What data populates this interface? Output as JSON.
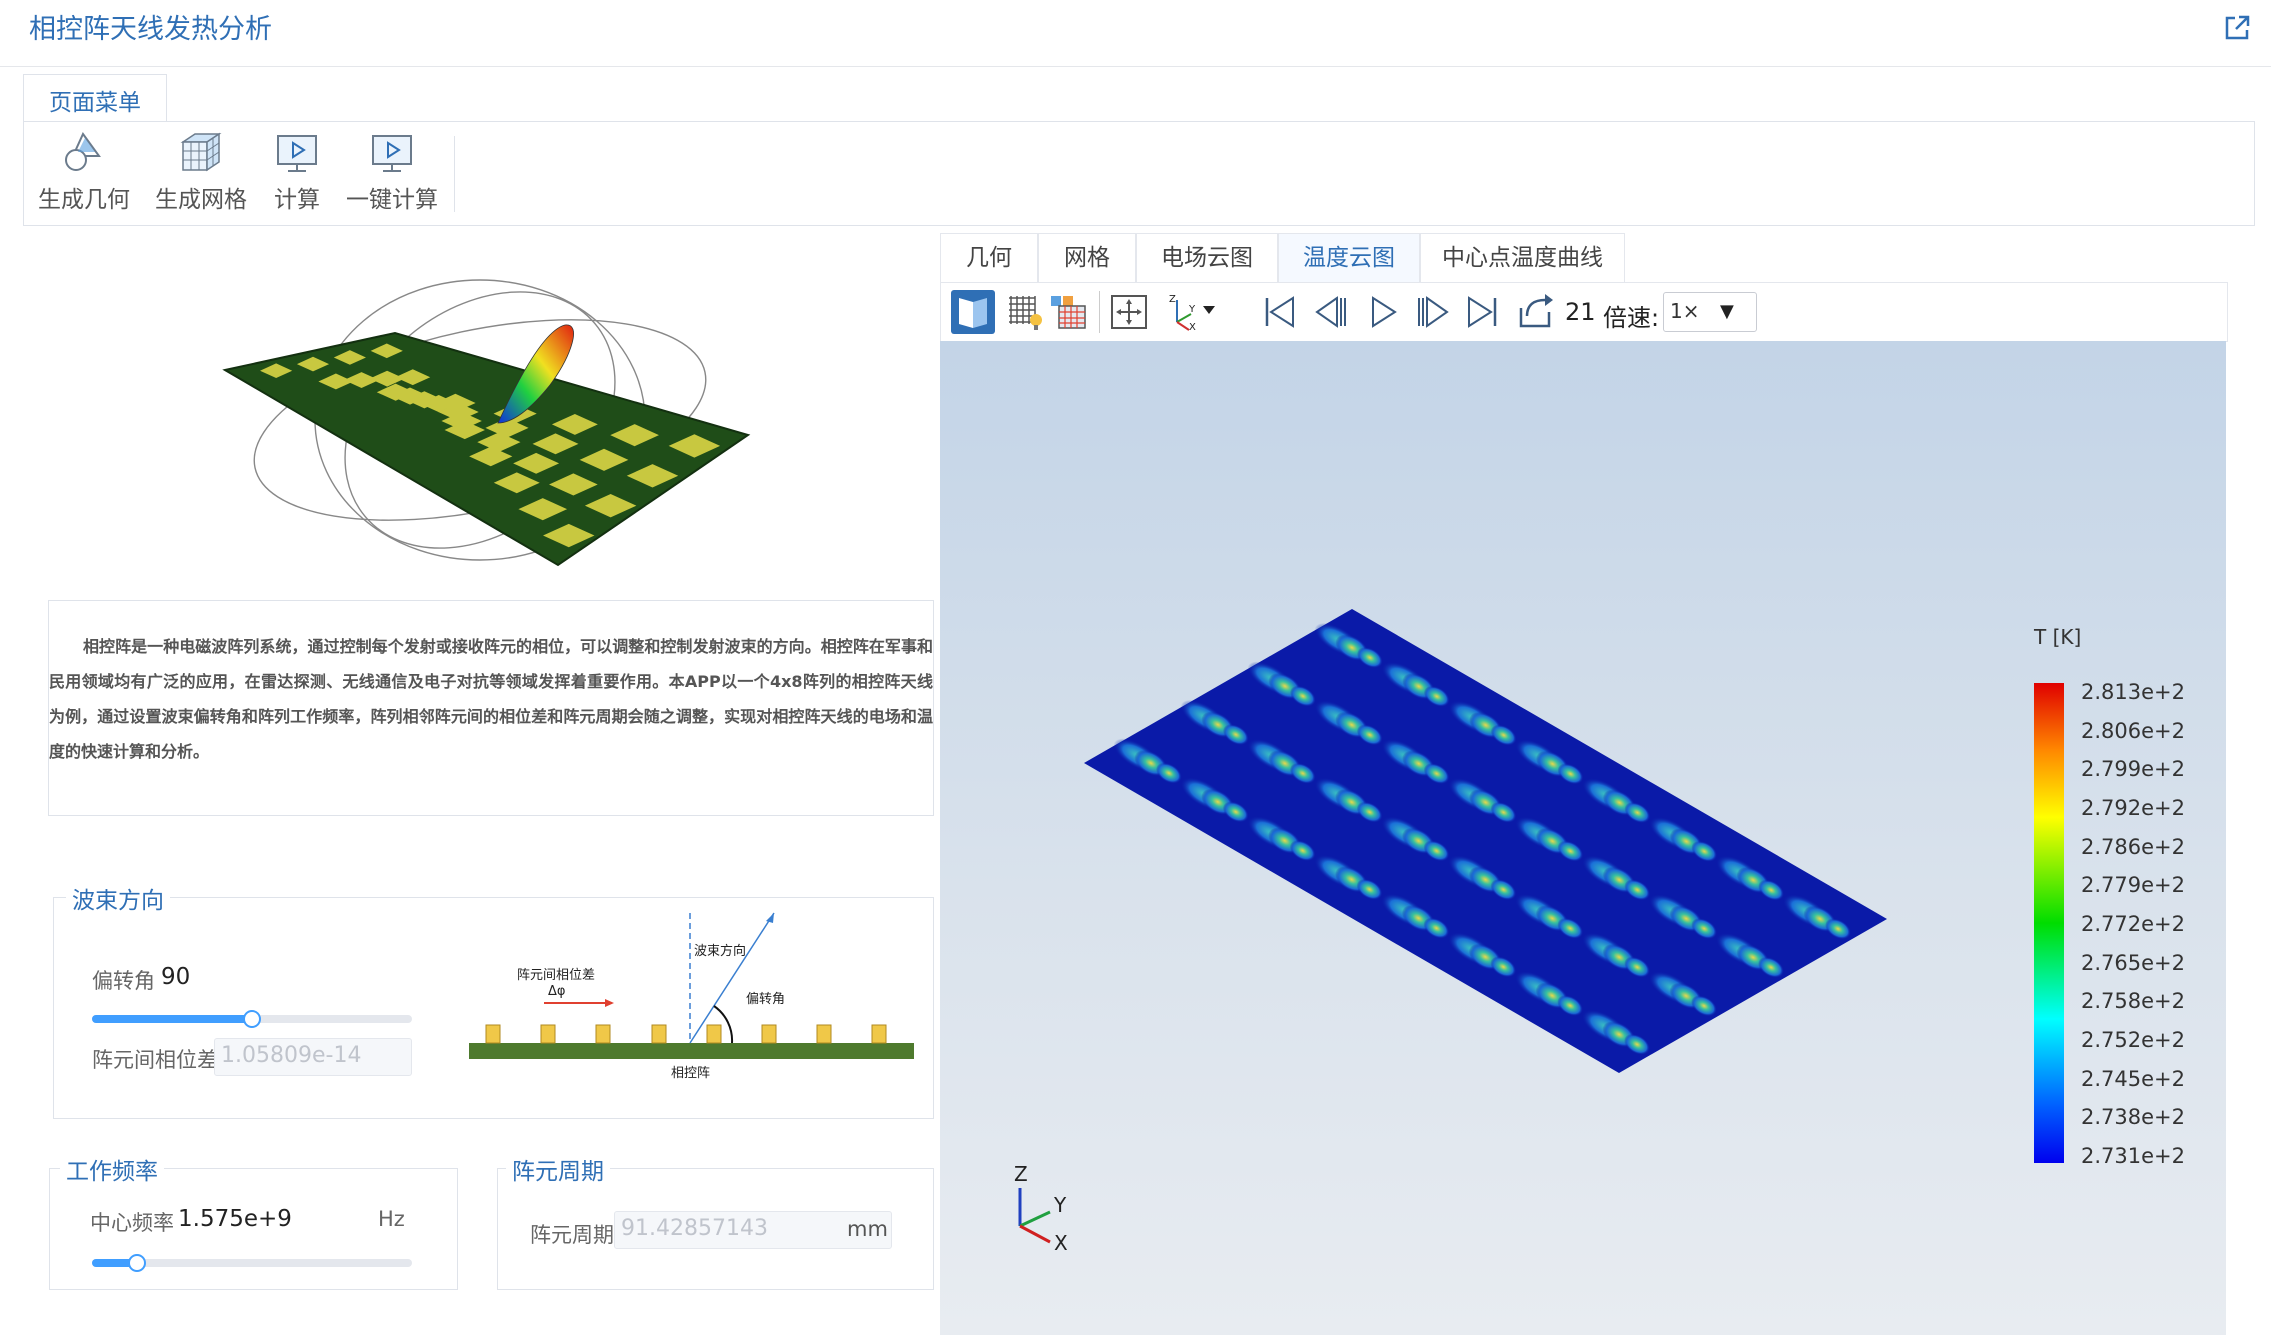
{
  "header": {
    "title": "相控阵天线发热分析",
    "external_icon": "external-link-icon"
  },
  "ribbon": {
    "tab_label": "页面菜单",
    "buttons": [
      {
        "label": "生成几何",
        "icon": "geometry-icon"
      },
      {
        "label": "生成网格",
        "icon": "mesh-icon"
      },
      {
        "label": "计算",
        "icon": "compute-icon"
      },
      {
        "label": "一键计算",
        "icon": "one-click-compute-icon"
      }
    ]
  },
  "description": "相控阵是一种电磁波阵列系统，通过控制每个发射或接收阵元的相位，可以调整和控制发射波束的方向。相控阵在军事和民用领域均有广泛的应用，在雷达探测、无线通信及电子对抗等领域发挥着重要作用。本APP以一个4x8阵列的相控阵天线为例，通过设置波束偏转角和阵列工作频率，阵列相邻阵元间的相位差和阵元周期会随之调整，实现对相控阵天线的电场和温度的快速计算和分析。",
  "beam": {
    "legend": "波束方向",
    "angle_label": "偏转角",
    "angle_value": "90",
    "angle_fraction": 0.5,
    "phase_label": "阵元间相位差",
    "phase_value": "1.05809e-14",
    "diagram": {
      "phase_diff_label": "阵元间相位差",
      "phase_symbol": "Δφ",
      "direction_label": "波束方向",
      "angle_label": "偏转角",
      "array_label": "相控阵"
    }
  },
  "freq": {
    "legend": "工作频率",
    "label": "中心频率",
    "value": "1.575e+9",
    "unit": "Hz",
    "fraction": 0.14
  },
  "period": {
    "legend": "阵元周期",
    "label": "阵元周期",
    "value": "91.42857143",
    "unit": "mm"
  },
  "viewer": {
    "tabs": [
      "几何",
      "网格",
      "电场云图",
      "温度云图",
      "中心点温度曲线"
    ],
    "active_tab": "温度云图",
    "toolbar_icons": [
      "surface-view-icon",
      "mesh-light-icon",
      "mesh-grid-icon",
      "fit-view-icon",
      "axis-orient-icon",
      "first-frame-icon",
      "prev-frame-icon",
      "play-icon",
      "next-frame-icon",
      "last-frame-icon",
      "loop-icon"
    ],
    "frame": "21",
    "speed_label": "倍速:",
    "speed_value": "1×",
    "legend_title": "T [K]",
    "legend_ticks": [
      "2.813e+2",
      "2.806e+2",
      "2.799e+2",
      "2.792e+2",
      "2.786e+2",
      "2.779e+2",
      "2.772e+2",
      "2.765e+2",
      "2.758e+2",
      "2.752e+2",
      "2.745e+2",
      "2.738e+2",
      "2.731e+2"
    ],
    "axis_labels": {
      "z": "Z",
      "y": "Y",
      "x": "X"
    },
    "colors": {
      "accent": "#2f6fb5",
      "plate": "#0a1aa8",
      "hot": "#e8d84a"
    }
  }
}
